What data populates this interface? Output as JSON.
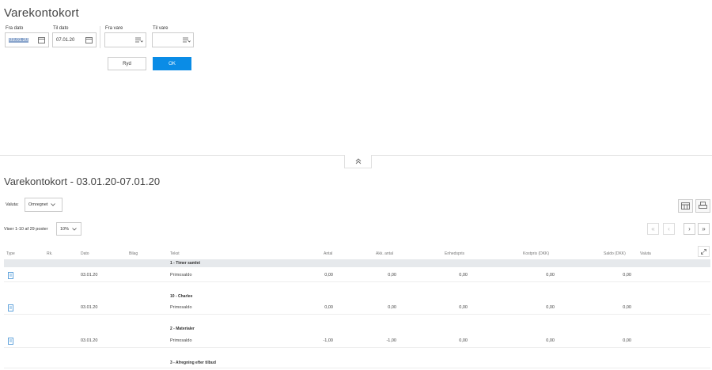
{
  "page": {
    "title": "Varekontokort"
  },
  "filters": {
    "fra_dato": {
      "label": "Fra dato",
      "value": "03.01.20"
    },
    "til_dato": {
      "label": "Til dato",
      "value": "07.01.20"
    },
    "fra_vare": {
      "label": "Fra vare",
      "value": ""
    },
    "til_vare": {
      "label": "Til vare",
      "value": ""
    }
  },
  "actions": {
    "clear_label": "Ryd",
    "ok_label": "OK"
  },
  "report": {
    "title": "Varekontokort - 03.01.20-07.01.20",
    "currency_label": "Valuta:",
    "currency_value": "Omregnet",
    "paging_text": "Viser 1-10 af 29 poster",
    "page_size": "10",
    "page_size_suffix": "%"
  },
  "columns": {
    "type": "Type",
    "rk": "Rk.",
    "dato": "Dato",
    "bilag": "Bilag",
    "tekst": "Tekst",
    "antal": "Antal",
    "akk_antal": "Akk. antal",
    "enhedspris": "Enhedspris",
    "kostpris": "Kostpris (DKK)",
    "saldo": "Saldo (DKK)",
    "valuta": "Valuta"
  },
  "groups": [
    {
      "name": "1 - Timer samlet",
      "rows": [
        {
          "dato": "03.01.20",
          "tekst": "Primosaldo",
          "antal": "0,00",
          "akk_antal": "0,00",
          "enhedspris": "0,00",
          "kostpris": "0,00",
          "saldo": "0,00"
        }
      ]
    },
    {
      "name": "10 - Charlee",
      "rows": [
        {
          "dato": "03.01.20",
          "tekst": "Primosaldo",
          "antal": "0,00",
          "akk_antal": "0,00",
          "enhedspris": "0,00",
          "kostpris": "0,00",
          "saldo": "0,00"
        }
      ]
    },
    {
      "name": "2 - Materialer",
      "rows": [
        {
          "dato": "03.01.20",
          "tekst": "Primosaldo",
          "antal": "-1,00",
          "akk_antal": "-1,00",
          "enhedspris": "0,00",
          "kostpris": "0,00",
          "saldo": "0,00"
        }
      ]
    },
    {
      "name": "3 - Afregning efter tilbud",
      "rows": []
    }
  ],
  "icons": {
    "calendar": "calendar-icon",
    "lookup": "list-lookup-icon",
    "collapse": "double-chevron-up-icon",
    "table_settings": "table-settings-icon",
    "print": "print-icon",
    "expand": "expand-icon",
    "row_type": "document-icon"
  },
  "colors": {
    "primary": "#0a8ce6",
    "group_bg": "#e6e9ec"
  }
}
